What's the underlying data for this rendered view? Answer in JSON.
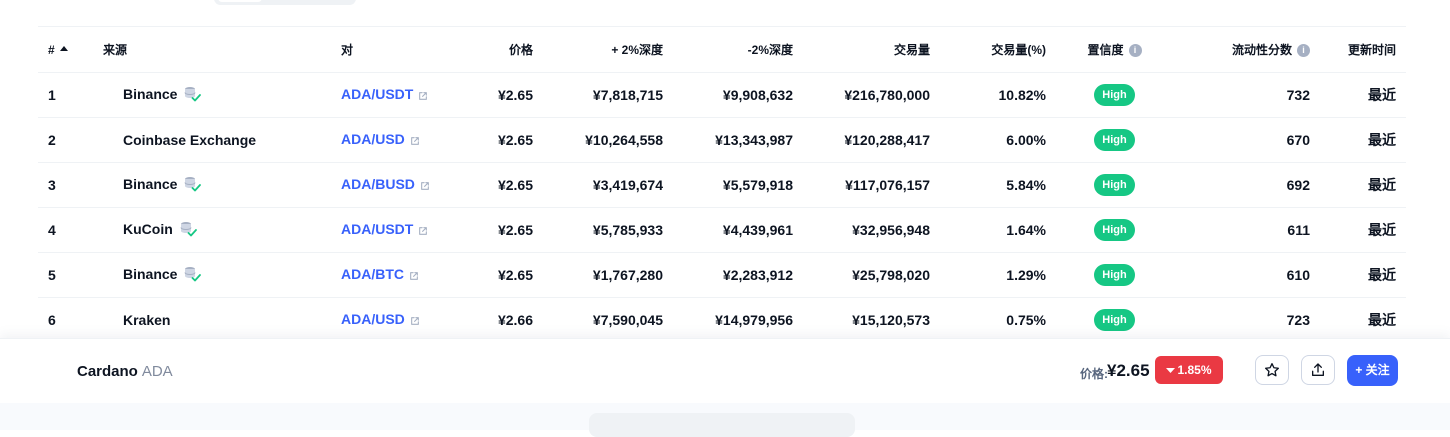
{
  "table": {
    "headers": {
      "rank": "#",
      "source": "来源",
      "pair": "对",
      "price": "价格",
      "depth_plus": "+ 2%深度",
      "depth_minus": "-2%深度",
      "volume": "交易量",
      "volume_pct": "交易量(%)",
      "confidence": "置信度",
      "liquidity": "流动性分数",
      "updated": "更新时间"
    },
    "rows": [
      {
        "rank": "1",
        "source": "Binance",
        "verified": true,
        "pair": "ADA/USDT",
        "price": "¥2.65",
        "depth_plus": "¥7,818,715",
        "depth_minus": "¥9,908,632",
        "volume": "¥216,780,000",
        "volume_pct": "10.82%",
        "confidence": "High",
        "liquidity": "732",
        "updated": "最近"
      },
      {
        "rank": "2",
        "source": "Coinbase Exchange",
        "verified": false,
        "pair": "ADA/USD",
        "price": "¥2.65",
        "depth_plus": "¥10,264,558",
        "depth_minus": "¥13,343,987",
        "volume": "¥120,288,417",
        "volume_pct": "6.00%",
        "confidence": "High",
        "liquidity": "670",
        "updated": "最近"
      },
      {
        "rank": "3",
        "source": "Binance",
        "verified": true,
        "pair": "ADA/BUSD",
        "price": "¥2.65",
        "depth_plus": "¥3,419,674",
        "depth_minus": "¥5,579,918",
        "volume": "¥117,076,157",
        "volume_pct": "5.84%",
        "confidence": "High",
        "liquidity": "692",
        "updated": "最近"
      },
      {
        "rank": "4",
        "source": "KuCoin",
        "verified": true,
        "pair": "ADA/USDT",
        "price": "¥2.65",
        "depth_plus": "¥5,785,933",
        "depth_minus": "¥4,439,961",
        "volume": "¥32,956,948",
        "volume_pct": "1.64%",
        "confidence": "High",
        "liquidity": "611",
        "updated": "最近"
      },
      {
        "rank": "5",
        "source": "Binance",
        "verified": true,
        "pair": "ADA/BTC",
        "price": "¥2.65",
        "depth_plus": "¥1,767,280",
        "depth_minus": "¥2,283,912",
        "volume": "¥25,798,020",
        "volume_pct": "1.29%",
        "confidence": "High",
        "liquidity": "610",
        "updated": "最近"
      },
      {
        "rank": "6",
        "source": "Kraken",
        "verified": false,
        "pair": "ADA/USD",
        "price": "¥2.66",
        "depth_plus": "¥7,590,045",
        "depth_minus": "¥14,979,956",
        "volume": "¥15,120,573",
        "volume_pct": "0.75%",
        "confidence": "High",
        "liquidity": "723",
        "updated": "最近"
      }
    ]
  },
  "sticky": {
    "coin_name": "Cardano",
    "coin_symbol": "ADA",
    "price_label": "价格:",
    "price_value": "¥2.65",
    "change": "1.85%",
    "follow_label": "+ 关注"
  },
  "colors": {
    "accent": "#3861fb",
    "positive": "#16c784",
    "negative": "#ea3943"
  },
  "icons": [
    "sort-up-icon",
    "info-icon",
    "verified-db-icon",
    "external-link-icon",
    "star-icon",
    "share-icon",
    "caret-down-icon"
  ]
}
